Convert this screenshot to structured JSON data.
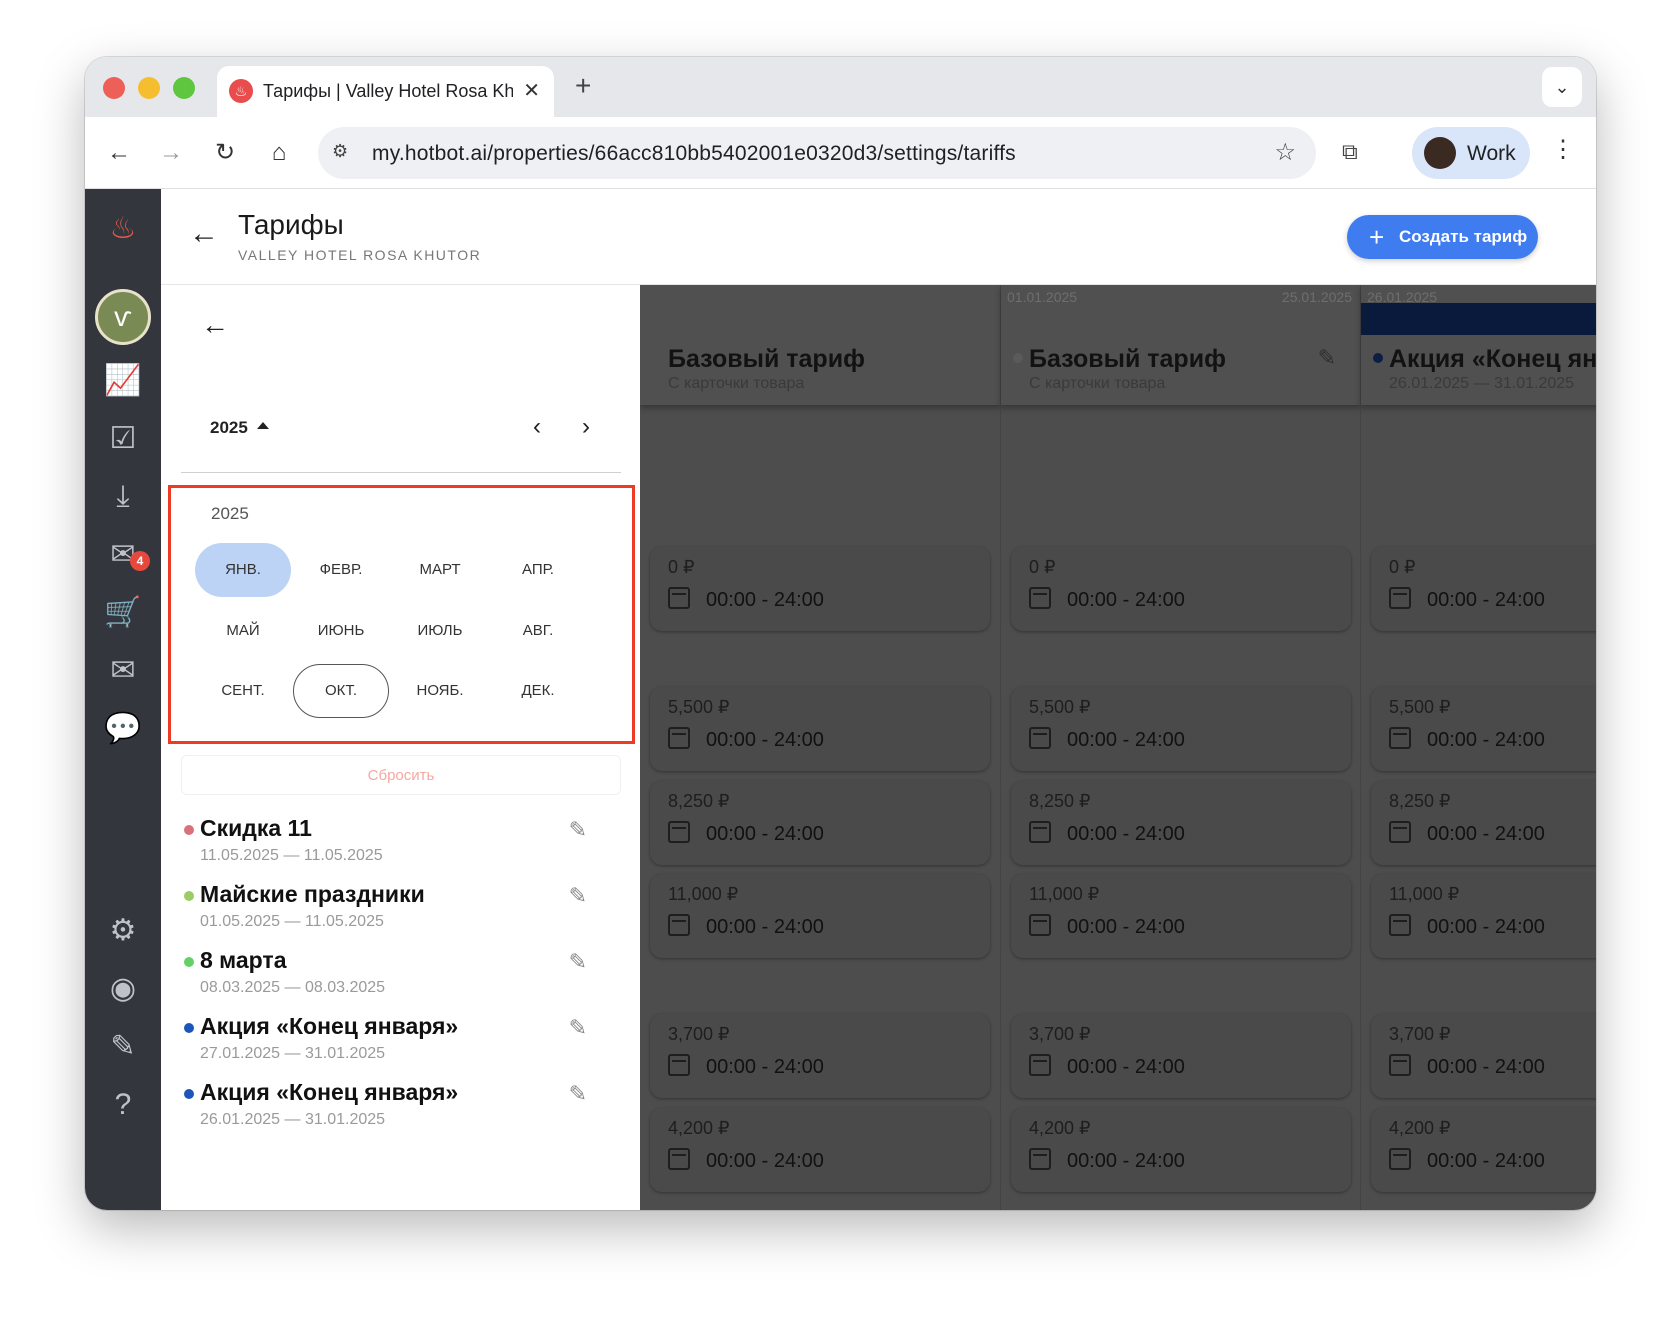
{
  "browser": {
    "tab_title": "Тарифы | Valley Hotel Rosa Khutor",
    "url": "my.hotbot.ai/properties/66acc810bb5402001e0320d3/settings/tariffs",
    "profile_label": "Work"
  },
  "header": {
    "title": "Тарифы",
    "subtitle": "VALLEY HOTEL ROSA KHUTOR",
    "create_button": "Создать тариф"
  },
  "sidebar": {
    "notification_badge": "4"
  },
  "picker": {
    "year_select": "2025",
    "grid_year": "2025",
    "months": [
      "ЯНВ.",
      "ФЕВР.",
      "МАРТ",
      "АПР.",
      "МАЙ",
      "ИЮНЬ",
      "ИЮЛЬ",
      "АВГ.",
      "СЕНТ.",
      "ОКТ.",
      "НОЯБ.",
      "ДЕК."
    ],
    "selected_month": "ЯНВ.",
    "current_month": "ОКТ.",
    "reset_label": "Сбросить"
  },
  "tariff_list": [
    {
      "name": "Скидка 11",
      "dates": "11.05.2025 — 11.05.2025",
      "color": "#d9707a"
    },
    {
      "name": "Майские праздники",
      "dates": "01.05.2025 — 11.05.2025",
      "color": "#9ccc65"
    },
    {
      "name": "8 марта",
      "dates": "08.03.2025 — 08.03.2025",
      "color": "#66d066"
    },
    {
      "name": "Акция «Конец января»",
      "dates": "27.01.2025 — 31.01.2025",
      "color": "#1e55b8"
    },
    {
      "name": "Акция «Конец января»",
      "dates": "26.01.2025 — 31.01.2025",
      "color": "#1e55b8"
    }
  ],
  "columns": [
    {
      "title": "Базовый тариф",
      "subtitle": "С карточки товара",
      "date_start": "",
      "date_end": ""
    },
    {
      "title": "Базовый тариф",
      "subtitle": "С карточки товара",
      "date_start": "01.01.2025",
      "date_end": "25.01.2025"
    },
    {
      "title": "Акция «Конец янв",
      "subtitle": "26.01.2025 — 31.01.2025",
      "date_start": "26.01.2025",
      "date_end": ""
    }
  ],
  "rate_rows": [
    {
      "price": "0 ₽",
      "time": "00:00 - 24:00"
    },
    {
      "price": "5,500 ₽",
      "time": "00:00 - 24:00"
    },
    {
      "price": "8,250 ₽",
      "time": "00:00 - 24:00"
    },
    {
      "price": "11,000 ₽",
      "time": "00:00 - 24:00"
    },
    {
      "price": "3,700 ₽",
      "time": "00:00 - 24:00"
    },
    {
      "price": "4,200 ₽",
      "time": "00:00 - 24:00"
    }
  ],
  "colors": {
    "accent": "#3f7cf0",
    "highlight_border": "#ec3a24",
    "sidebar_bg": "#33373d"
  }
}
